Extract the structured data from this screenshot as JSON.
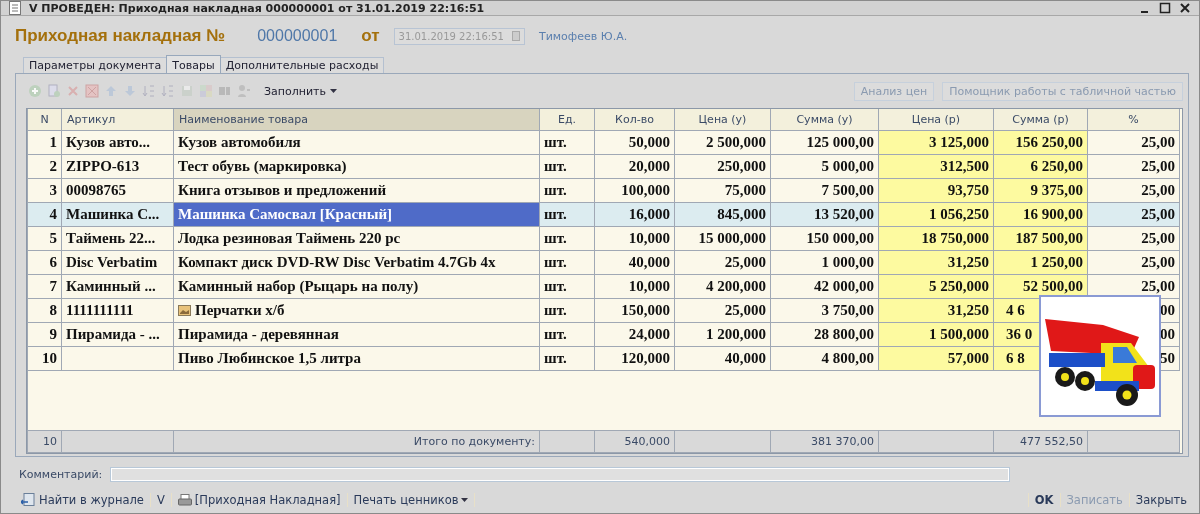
{
  "window": {
    "title": "V ПРОВЕДЕН: Приходная накладная 000000001 от 31.01.2019 22:16:51"
  },
  "header": {
    "title": "Приходная накладная №",
    "number": "000000001",
    "from_label": "от",
    "date": "31.01.2019 22:16:51",
    "author": "Тимофеев Ю.А."
  },
  "tabs": [
    {
      "label": "Параметры документа",
      "selected": false
    },
    {
      "label": "Товары",
      "selected": true
    },
    {
      "label": "Дополнительные расходы",
      "selected": false
    }
  ],
  "toolbar": {
    "fill_menu": "Заполнить",
    "buttons": [
      {
        "label": "Анализ цен",
        "disabled": true
      },
      {
        "label": "Помощник работы с табличной частью",
        "disabled": true
      }
    ]
  },
  "table": {
    "columns": [
      {
        "label": "N",
        "sorted": false,
        "highlighted": false
      },
      {
        "label": "Артикул",
        "sorted": false,
        "highlighted": false
      },
      {
        "label": "Наименование товара",
        "sorted": true,
        "highlighted": false
      },
      {
        "label": "Ед.",
        "sorted": false,
        "highlighted": false
      },
      {
        "label": "Кол-во",
        "sorted": false,
        "highlighted": false
      },
      {
        "label": "Цена (у)",
        "sorted": false,
        "highlighted": false
      },
      {
        "label": "Сумма (у)",
        "sorted": false,
        "highlighted": false
      },
      {
        "label": "Цена (р)",
        "sorted": false,
        "highlighted": true
      },
      {
        "label": "Сумма (р)",
        "sorted": false,
        "highlighted": true
      },
      {
        "label": "%",
        "sorted": false,
        "highlighted": false
      }
    ],
    "rows": [
      {
        "cells": [
          "1",
          "Кузов авто...",
          "Кузов автомобиля",
          "шт.",
          "50,000",
          "2 500,000",
          "125 000,00",
          "3 125,000",
          "156 250,00",
          "25,00"
        ],
        "selected": false,
        "has_image": false,
        "partly_hidden": false
      },
      {
        "cells": [
          "2",
          "ZIPPO-613",
          "Тест обувь (маркировка)",
          "шт.",
          "20,000",
          "250,000",
          "5 000,00",
          "312,500",
          "6 250,00",
          "25,00"
        ],
        "selected": false,
        "has_image": false,
        "partly_hidden": false
      },
      {
        "cells": [
          "3",
          "00098765",
          "Книга отзывов и предложений",
          "шт.",
          "100,000",
          "75,000",
          "7 500,00",
          "93,750",
          "9 375,00",
          "25,00"
        ],
        "selected": false,
        "has_image": false,
        "partly_hidden": false
      },
      {
        "cells": [
          "4",
          "Машинка С...",
          "Машинка Самосвал [Красный]",
          "шт.",
          "16,000",
          "845,000",
          "13 520,00",
          "1 056,250",
          "16 900,00",
          "25,00"
        ],
        "selected": true,
        "has_image": false,
        "partly_hidden": false
      },
      {
        "cells": [
          "5",
          "Таймень 22...",
          "Лодка резиновая Таймень 220 рс",
          "шт.",
          "10,000",
          "15 000,000",
          "150 000,00",
          "18 750,000",
          "187 500,00",
          "25,00"
        ],
        "selected": false,
        "has_image": false,
        "partly_hidden": false
      },
      {
        "cells": [
          "6",
          "Disc Verbatim",
          "Компакт диск DVD-RW Disc Verbatim 4.7Gb 4x",
          "шт.",
          "40,000",
          "25,000",
          "1 000,00",
          "31,250",
          "1 250,00",
          "25,00"
        ],
        "selected": false,
        "has_image": false,
        "partly_hidden": false
      },
      {
        "cells": [
          "7",
          "Каминный ...",
          "Каминный набор (Рыцарь на полу)",
          "шт.",
          "10,000",
          "4 200,000",
          "42 000,00",
          "5 250,000",
          "52 500,00",
          "25,00"
        ],
        "selected": false,
        "has_image": false,
        "partly_hidden": false
      },
      {
        "cells": [
          "8",
          "1111111111",
          "Перчатки х/б",
          "шт.",
          "150,000",
          "25,000",
          "3 750,00",
          "31,250",
          "4 6",
          "00"
        ],
        "selected": false,
        "has_image": true,
        "partly_hidden": true
      },
      {
        "cells": [
          "9",
          "Пирамида - ...",
          "Пирамида - деревянная",
          "шт.",
          "24,000",
          "1 200,000",
          "28 800,00",
          "1 500,000",
          "36 0",
          "00"
        ],
        "selected": false,
        "has_image": false,
        "partly_hidden": true
      },
      {
        "cells": [
          "10",
          "",
          "Пиво Любинское 1,5 литра",
          "шт.",
          "120,000",
          "40,000",
          "4 800,00",
          "57,000",
          "6 8",
          "50"
        ],
        "selected": false,
        "has_image": false,
        "partly_hidden": true
      }
    ],
    "totals": {
      "count": "10",
      "label": "Итого по документу:",
      "qty": "540,000",
      "sum_u": "381 370,00",
      "sum_r": "477 552,50"
    }
  },
  "comment": {
    "label": "Комментарий:"
  },
  "actions": [
    {
      "label": "Найти в журнале",
      "kind": "journal"
    },
    {
      "label": "V",
      "kind": "plain"
    },
    {
      "label": "[Приходная Накладная]",
      "kind": "print"
    },
    {
      "label": "Печать ценников",
      "kind": "menu"
    }
  ],
  "dialog_buttons": [
    {
      "label": "OK",
      "default": true,
      "disabled": false
    },
    {
      "label": "Записать",
      "default": false,
      "disabled": true
    },
    {
      "label": "Закрыть",
      "default": false,
      "disabled": false
    }
  ]
}
